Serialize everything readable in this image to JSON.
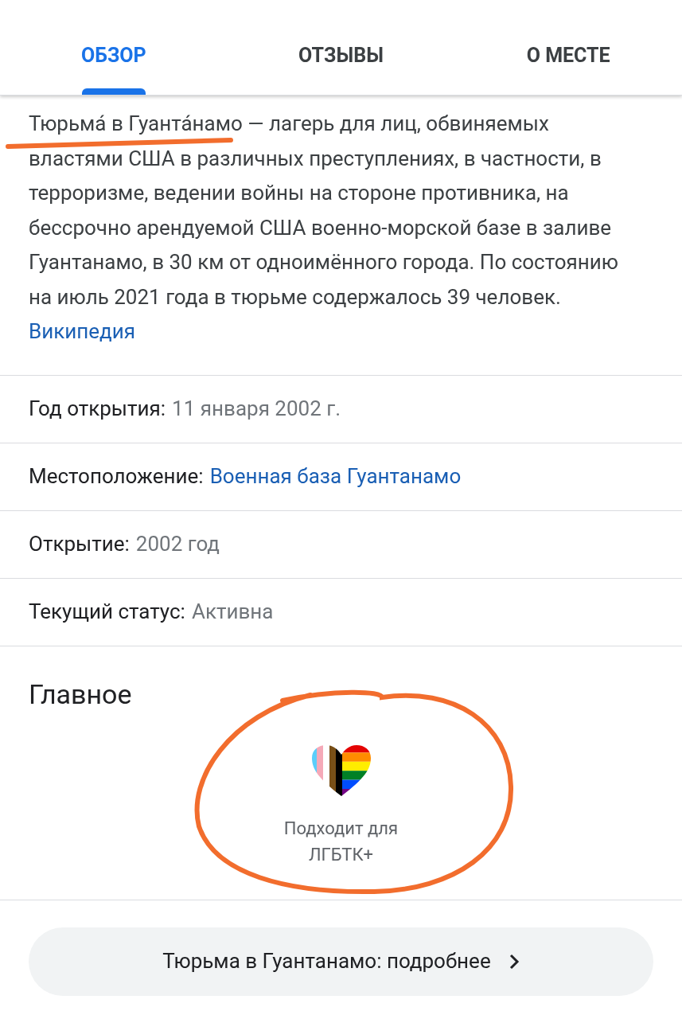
{
  "tabs": [
    {
      "label": "ОБЗОР",
      "selected": true
    },
    {
      "label": "ОТЗЫВЫ",
      "selected": false
    },
    {
      "label": "О МЕСТЕ",
      "selected": false
    }
  ],
  "description": {
    "text": "Тюрьма́ в Гуанта́намо — лагерь для лиц, обвиняемых властями США в различных преступлениях, в частности, в терроризме, ведении войны на стороне противника, на бессрочно арендуемой США военно-морской базе в заливе Гуантанамо, в 30 км от одноимённого города. По состоянию на июль 2021 года в тюрьме содержалось 39 человек.",
    "link": "Википедия"
  },
  "facts": [
    {
      "label": "Год открытия:",
      "value": "11 января 2002 г.",
      "kind": "plain"
    },
    {
      "label": "Местоположение:",
      "value": "Военная база Гуантанамо",
      "kind": "link"
    },
    {
      "label": "Открытие:",
      "value": "2002 год",
      "kind": "plain"
    },
    {
      "label": "Текущий статус:",
      "value": "Активна",
      "kind": "plain"
    }
  ],
  "highlights": {
    "title": "Главное",
    "items": [
      {
        "caption": "Подходит для ЛГБТК+"
      }
    ]
  },
  "more_button": {
    "label": "Тюрьма в Гуантанамо: подробнее"
  }
}
